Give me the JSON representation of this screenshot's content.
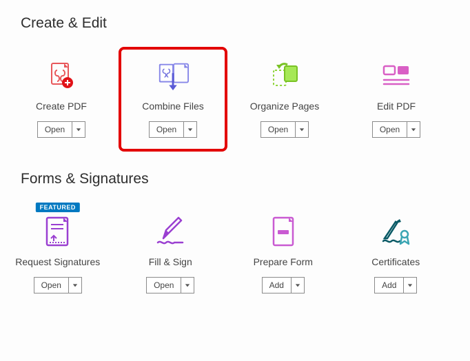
{
  "sections": {
    "create_edit": {
      "title": "Create & Edit",
      "tools": {
        "create_pdf": {
          "label": "Create PDF",
          "button": "Open"
        },
        "combine_files": {
          "label": "Combine Files",
          "button": "Open"
        },
        "organize": {
          "label": "Organize Pages",
          "button": "Open"
        },
        "edit_pdf": {
          "label": "Edit PDF",
          "button": "Open"
        }
      }
    },
    "forms": {
      "title": "Forms & Signatures",
      "tools": {
        "request_sig": {
          "label": "Request Signatures",
          "button": "Open",
          "badge": "FEATURED"
        },
        "fill_sign": {
          "label": "Fill & Sign",
          "button": "Open"
        },
        "prepare_form": {
          "label": "Prepare Form",
          "button": "Add"
        },
        "certificates": {
          "label": "Certificates",
          "button": "Add"
        }
      }
    }
  }
}
